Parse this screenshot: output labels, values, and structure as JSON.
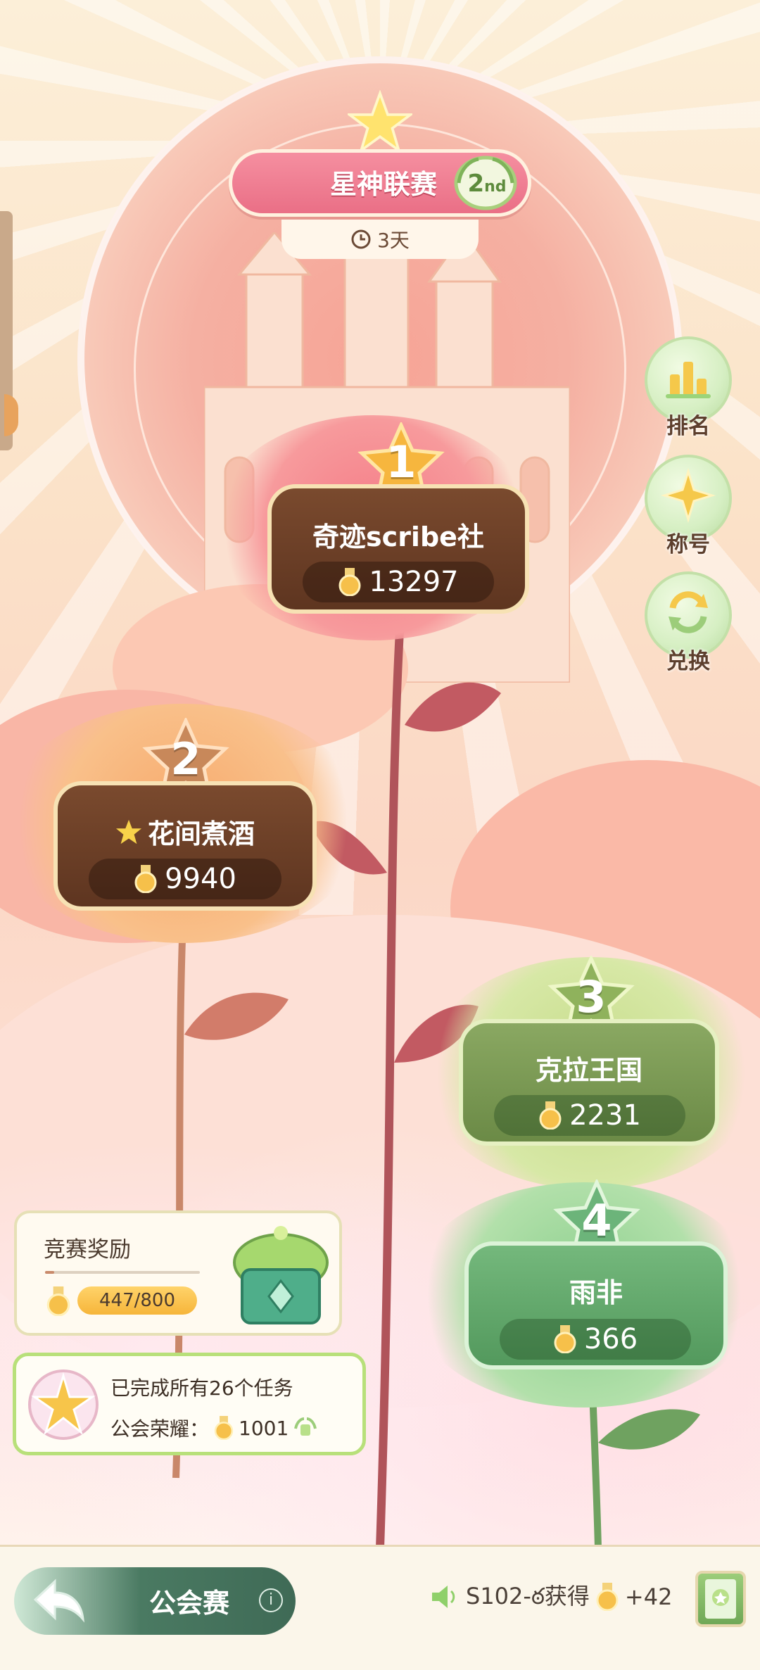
{
  "header": {
    "title": "星神联赛",
    "rank_num": "2",
    "rank_suffix": "nd",
    "timer": "3天"
  },
  "side_buttons": [
    {
      "label": "排名",
      "icon": "bar-chart-icon"
    },
    {
      "label": "称号",
      "icon": "sparkle-icon"
    },
    {
      "label": "兑换",
      "icon": "exchange-icon"
    }
  ],
  "guilds": [
    {
      "rank": "1",
      "name": "奇迹scribe社",
      "score": "13297"
    },
    {
      "rank": "2",
      "name": "花间煮酒",
      "score": "9940"
    },
    {
      "rank": "3",
      "name": "克拉王国",
      "score": "2231"
    },
    {
      "rank": "4",
      "name": "雨非",
      "score": "366"
    }
  ],
  "reward": {
    "title": "竞赛奖励",
    "current": "447",
    "max": "/800",
    "progress": 0.06
  },
  "tasks": {
    "line1": "已完成所有26个任务",
    "honor_label": "公会荣耀：",
    "honor_value": "1001"
  },
  "bottom": {
    "back_label": "公会赛",
    "info_glyph": "i",
    "ticker_text": "S102-ఠ获得",
    "ticker_plus": "+42"
  },
  "colors": {
    "brown_card": "#6a3f26",
    "olive_card": "#7c9a54",
    "green_card": "#5fa867",
    "title_pink": "#ee7a8e",
    "gold": "#f6b53a"
  }
}
